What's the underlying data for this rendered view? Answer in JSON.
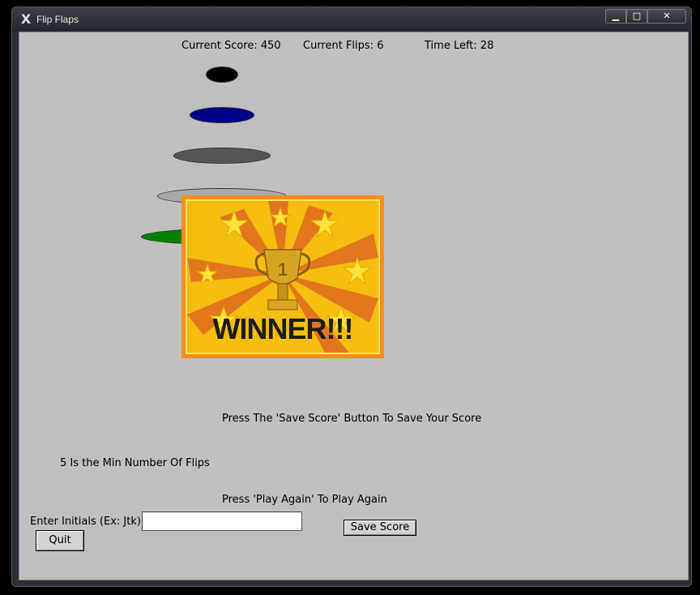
{
  "window": {
    "title": "Flip Flaps"
  },
  "status": {
    "score": "Current Score: 450",
    "flips": "Current Flips: 6",
    "time": "Time Left: 28"
  },
  "disks": [
    {
      "color": "#000000"
    },
    {
      "color": "#00008b"
    },
    {
      "color": "#555555"
    },
    {
      "color": "#a9a9a9"
    },
    {
      "color": "#008000"
    }
  ],
  "winner": {
    "text": "WINNER!!!",
    "trophy_number": "1"
  },
  "messages": {
    "save_prompt": "Press The 'Save Score' Button To Save Your Score",
    "min_flips": "5 Is the Min Number Of Flips",
    "play_again": "Press 'Play Again' To Play Again"
  },
  "form": {
    "initials_label": "Enter Initials (Ex: Jtk)",
    "initials_value": "",
    "save_label": "Save Score",
    "quit_label": "Quit"
  }
}
